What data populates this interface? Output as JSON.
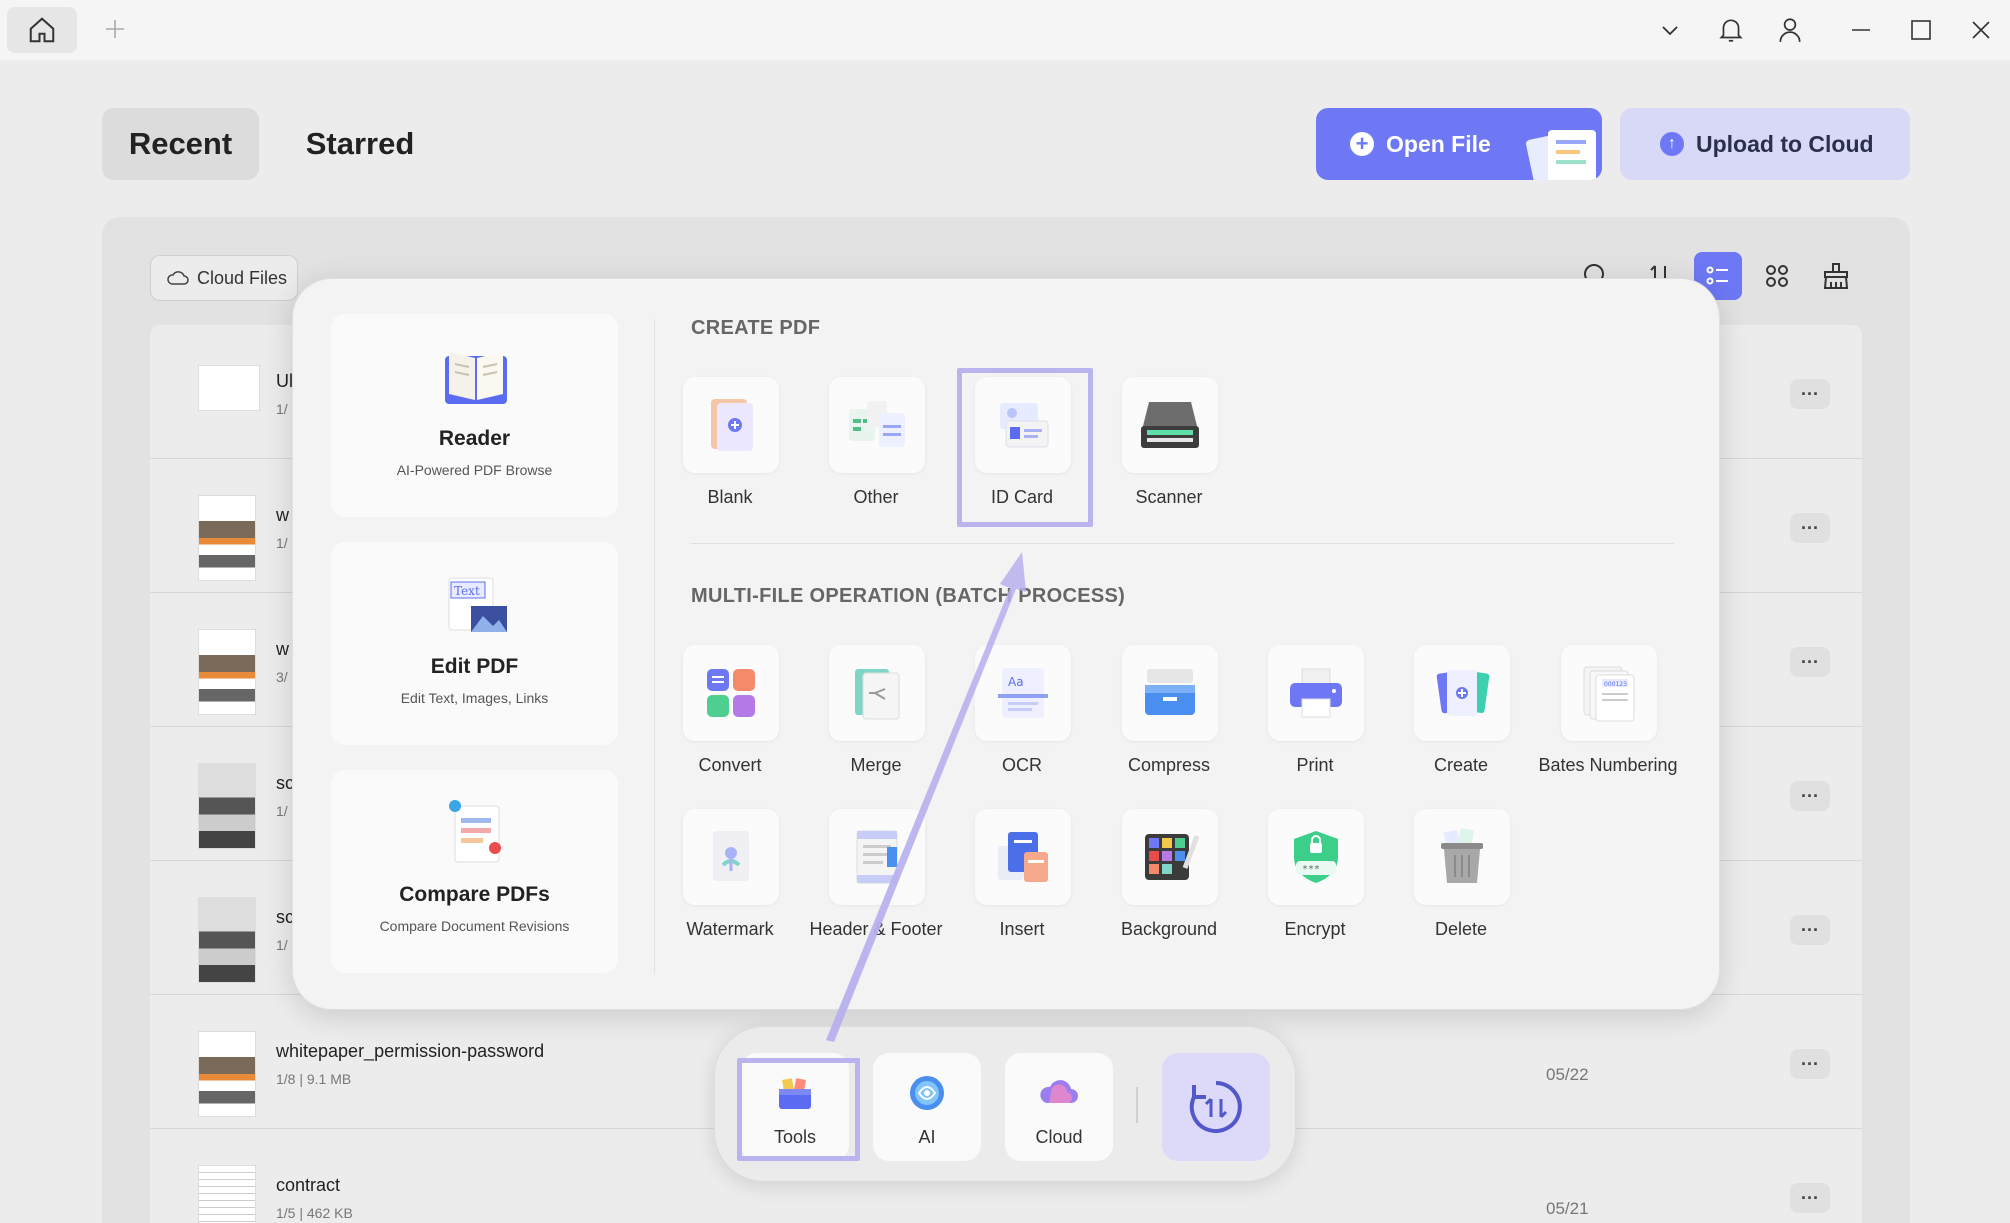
{
  "tabs": {
    "recent": "Recent",
    "starred": "Starred"
  },
  "actions": {
    "open_file": "Open File",
    "upload_cloud": "Upload to Cloud"
  },
  "cloud_files": "Cloud Files",
  "files": [
    {
      "name": "Ul",
      "meta": "1/",
      "date": ""
    },
    {
      "name": "w",
      "meta": "1/",
      "date": ""
    },
    {
      "name": "w",
      "meta": "3/",
      "date": ""
    },
    {
      "name": "sc",
      "meta": "1/",
      "date": ""
    },
    {
      "name": "sc",
      "meta": "1/",
      "date": ""
    },
    {
      "name": "whitepaper_permission-password",
      "meta": "1/8 | 9.1 MB",
      "date": "05/22"
    },
    {
      "name": "contract",
      "meta": "1/5 | 462 KB",
      "date": "05/21"
    }
  ],
  "features": [
    {
      "title": "Reader",
      "subtitle": "AI-Powered PDF Browse"
    },
    {
      "title": "Edit PDF",
      "subtitle": "Edit Text, Images, Links"
    },
    {
      "title": "Compare PDFs",
      "subtitle": "Compare Document Revisions"
    }
  ],
  "sections": {
    "create": "CREATE PDF",
    "batch": "MULTI-FILE OPERATION (BATCH PROCESS)"
  },
  "create_tools": [
    "Blank",
    "Other",
    "ID Card",
    "Scanner"
  ],
  "batch_tools_row1": [
    "Convert",
    "Merge",
    "OCR",
    "Compress",
    "Print",
    "Create",
    "Bates Numbering"
  ],
  "batch_tools_row2": [
    "Watermark",
    "Header & Footer",
    "Insert",
    "Background",
    "Encrypt",
    "Delete"
  ],
  "dock": {
    "tools": "Tools",
    "ai": "AI",
    "cloud": "Cloud"
  },
  "colors": {
    "accent": "#6e78f5",
    "highlight": "#b9b3ef"
  }
}
